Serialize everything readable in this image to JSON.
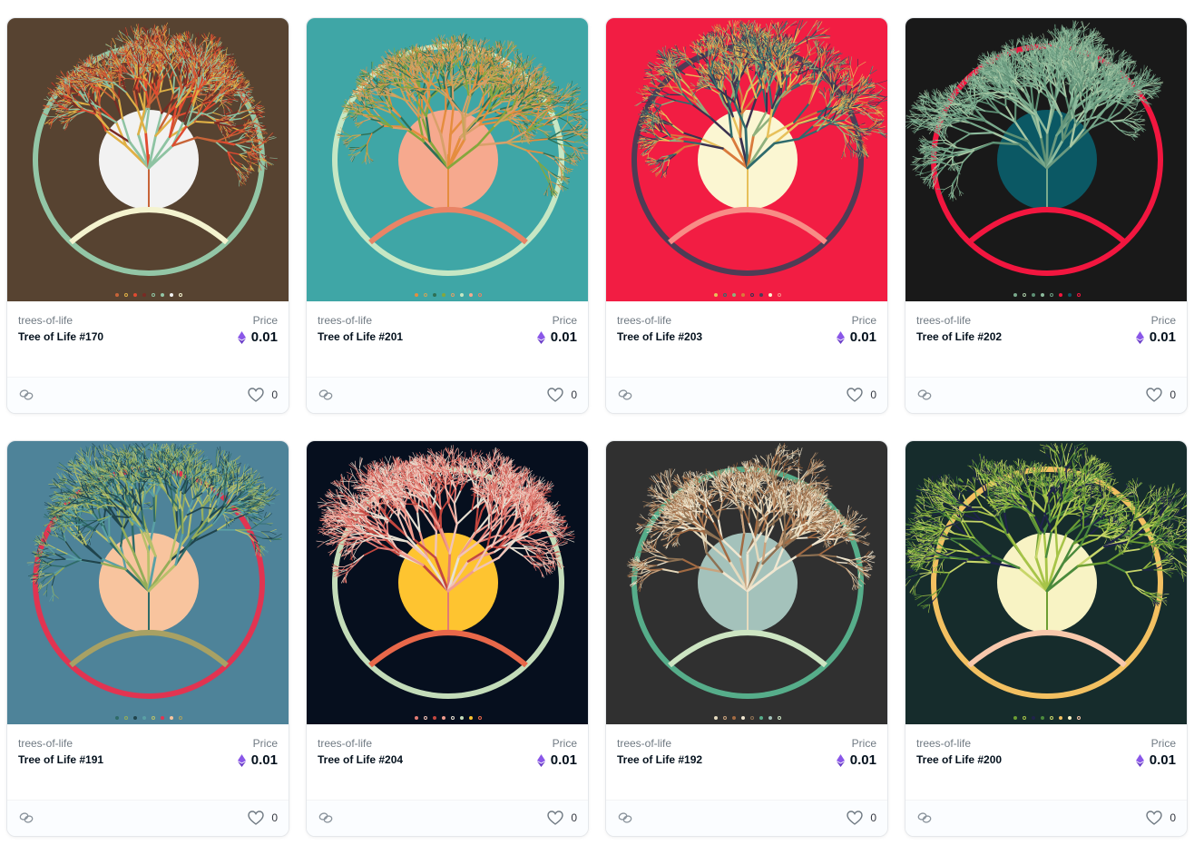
{
  "cards": [
    {
      "collection": "trees-of-life",
      "name": "Tree of Life #170",
      "price_label": "Price",
      "price": "0.01",
      "likes": "0",
      "colors": {
        "bg": "#574331",
        "sun": "#f2f2f2",
        "ring": "#93c6a6",
        "arc": "#f4f3cf",
        "leaves": [
          "#c86438",
          "#e0b045",
          "#e04a30",
          "#7a2a24",
          "#8ec3a2"
        ]
      }
    },
    {
      "collection": "trees-of-life",
      "name": "Tree of Life #201",
      "price_label": "Price",
      "price": "0.01",
      "likes": "0",
      "colors": {
        "bg": "#3fa6a6",
        "sun": "#f6a98e",
        "ring": "#c6e7c4",
        "arc": "#e98466",
        "leaves": [
          "#e58d3e",
          "#c9a55a",
          "#2e7055",
          "#85a73c",
          "#d9a06a"
        ]
      }
    },
    {
      "collection": "trees-of-life",
      "name": "Tree of Life #203",
      "price_label": "Price",
      "price": "0.01",
      "likes": "0",
      "colors": {
        "bg": "#f21d43",
        "sun": "#fbf6d2",
        "ring": "#4e3c55",
        "arc": "#f88c86",
        "leaves": [
          "#e7c05a",
          "#2f6b6d",
          "#8fb07c",
          "#d97a3c",
          "#3a3250"
        ]
      }
    },
    {
      "collection": "trees-of-life",
      "name": "Tree of Life #202",
      "price_label": "Price",
      "price": "0.01",
      "likes": "0",
      "colors": {
        "bg": "#191919",
        "sun": "#0b5864",
        "ring": "#f2163f",
        "arc": "#f2163f",
        "leaves": [
          "#79a98c",
          "#a7c6a3",
          "#5d8f74",
          "#8dbb9d",
          "#6b9a80"
        ]
      }
    },
    {
      "collection": "trees-of-life",
      "name": "Tree of Life #191",
      "price_label": "Price",
      "price": "0.01",
      "likes": "0",
      "colors": {
        "bg": "#4e8399",
        "sun": "#f8c49e",
        "ring": "#e13451",
        "arc": "#a8a164",
        "leaves": [
          "#2f6b68",
          "#94ad59",
          "#20444c",
          "#5aa0a5",
          "#b8c06a"
        ]
      }
    },
    {
      "collection": "trees-of-life",
      "name": "Tree of Life #204",
      "price_label": "Price",
      "price": "0.01",
      "likes": "0",
      "colors": {
        "bg": "#060f1e",
        "sun": "#fec430",
        "ring": "#c3dcb9",
        "arc": "#e8684a",
        "leaves": [
          "#e27b75",
          "#f1c3b8",
          "#c4473f",
          "#f09b8d",
          "#e8e1d3"
        ]
      }
    },
    {
      "collection": "trees-of-life",
      "name": "Tree of Life #192",
      "price_label": "Price",
      "price": "0.01",
      "likes": "0",
      "colors": {
        "bg": "#303030",
        "sun": "#a4c2bb",
        "ring": "#56ad8a",
        "arc": "#cde5c2",
        "leaves": [
          "#e6dbbf",
          "#c9a27c",
          "#a36a42",
          "#f0e6d0",
          "#8e7153"
        ]
      }
    },
    {
      "collection": "trees-of-life",
      "name": "Tree of Life #200",
      "price_label": "Price",
      "price": "0.01",
      "likes": "0",
      "colors": {
        "bg": "#162c2c",
        "sun": "#f8f3c4",
        "ring": "#f3c061",
        "arc": "#f8c8ac",
        "leaves": [
          "#6d9e33",
          "#a7c448",
          "#20234c",
          "#4b8a3c",
          "#c8d66a"
        ]
      }
    }
  ],
  "icons": {
    "link": "link-icon",
    "favorite": "heart-icon",
    "currency": "eth-icon"
  },
  "colors": {
    "eth": "#8a57e8",
    "muted": "#707a83",
    "text": "#04111d"
  }
}
